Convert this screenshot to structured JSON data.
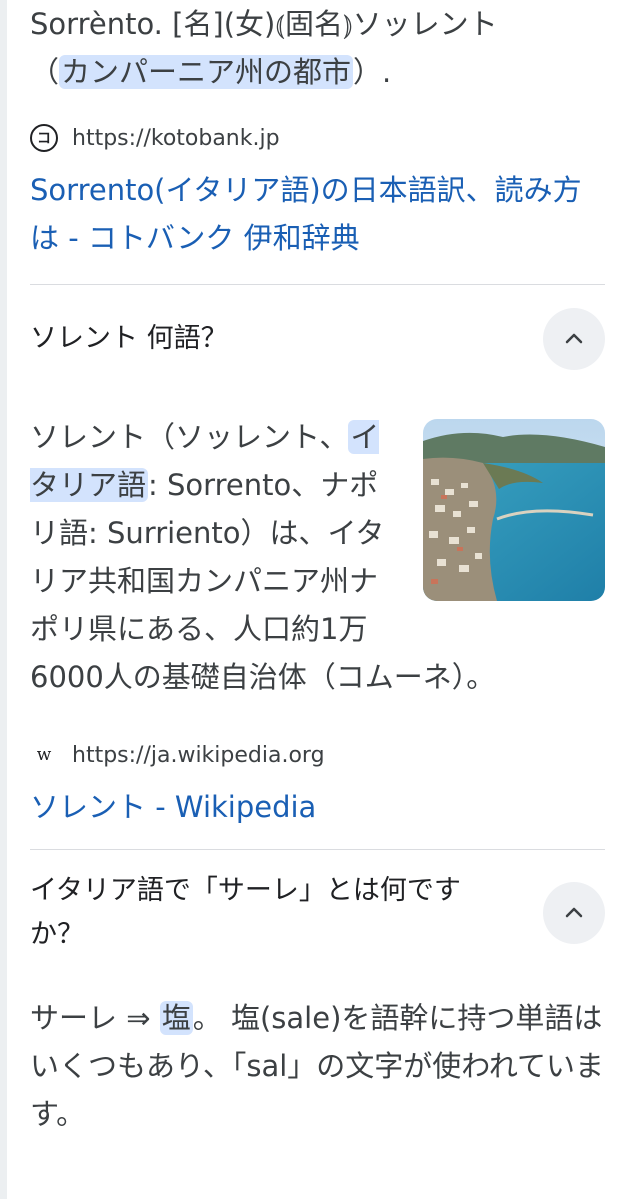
{
  "top_snippet": {
    "line1": "Sorrènto. [名](女)⦅固名⦆ソッレント",
    "line2_prefix": "（",
    "line2_highlight": "カンパーニア州の都市",
    "line2_suffix": "）."
  },
  "kotobank": {
    "favicon": "コ",
    "url": "https://kotobank.jp",
    "link_title": "Sorrento(イタリア語)の日本語訳、読み方は - コトバンク 伊和辞典"
  },
  "faq1": {
    "question": "ソレント 何語？",
    "chevron_icon": "chevron-up-icon",
    "answer_prefix": "ソレント（ソッレント、",
    "answer_highlight": "イタリア語",
    "answer_rest": ": Sorrento、ナポリ語: Surriento）は、イタリア共和国カンパニア州ナポリ県にある、人口約1万6000人の基礎自治体（コムーネ）。",
    "source_favicon": "w",
    "source_url": "https://ja.wikipedia.org",
    "link_title": "ソレント - Wikipedia"
  },
  "faq2": {
    "question": "イタリア語で「サーレ」とは何ですか？",
    "chevron_icon": "chevron-up-icon",
    "answer_prefix": "サーレ ⇒ ",
    "answer_highlight": "塩",
    "answer_rest": "。 塩(sale)を語幹に持つ単語はいくつもあり、「sal」の文字が使われています。"
  },
  "colors": {
    "link": "#1a5fb4",
    "highlight": "#d3e3fd",
    "chevron_bg": "#eef0f3"
  }
}
